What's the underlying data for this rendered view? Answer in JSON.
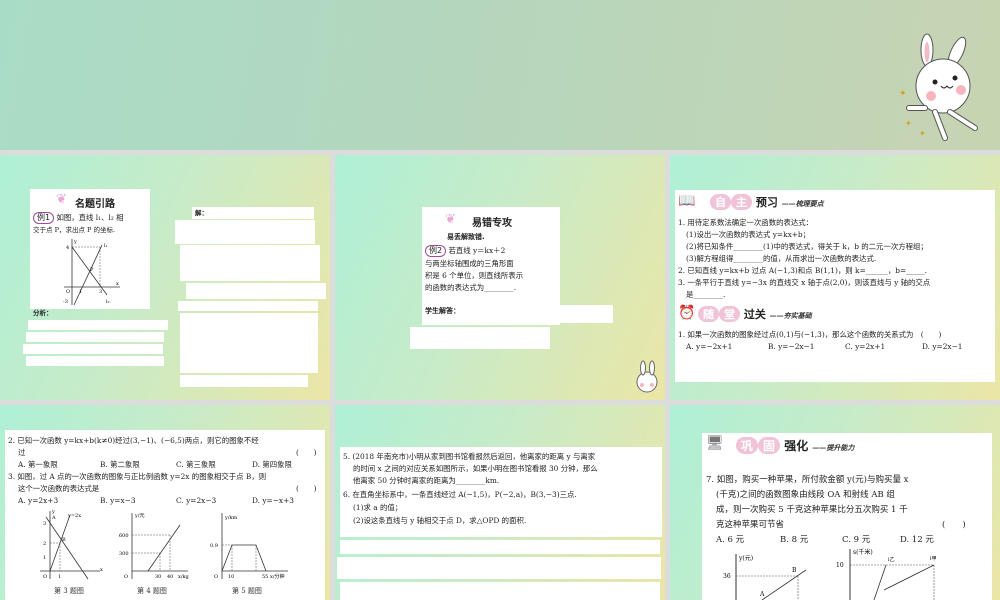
{
  "colors": {
    "banner": "#b4d6bd",
    "pink": "#f1c3d8",
    "mint": "#aef0d6",
    "yellow": "#ebe6a6"
  },
  "icons": [
    "bunny-mascot-icon",
    "butterfly-icon",
    "book-icon",
    "alarm-clock-icon",
    "blackboard-icon"
  ],
  "slide1": {
    "title": "名题引路",
    "example": "例1",
    "q1": "如图，直线 l₁、l₂ 相",
    "q2": "交于点 P，求出点 P 的坐标.",
    "analysis": "分析：",
    "solution": "解：",
    "graph": {
      "y4": "4",
      "ym3": "-3",
      "x1": "1",
      "x3": "3",
      "o": "O",
      "p": "P",
      "l1": "l₁",
      "l2": "l₂",
      "x": "x",
      "y": "y"
    }
  },
  "slide2": {
    "title": "易错专攻",
    "subtitle": "易丢解致错.",
    "example": "例2",
    "lines": [
      "若直线 y＝kx＋2",
      "与两坐标轴围成的三角形面",
      "积是 6 个单位，则直线所表示",
      "的函数的表达式为________."
    ],
    "answer": "学生解答："
  },
  "slide3": {
    "sec1": {
      "pills": [
        "自",
        "主"
      ],
      "title": "预习",
      "sub": "——梳理要点"
    },
    "lines": [
      "1. 用待定系数法确定一次函数的表达式：",
      "(1)设出一次函数的表达式 y=kx+b；",
      "(2)将已知条件________(1)中的表达式，得关于 k，b 的二元一次方程组；",
      "(3)解方程组得________的值，从而求出一次函数的表达式.",
      "2. 已知直线 y=kx+b 过点 A(−1,3)和点 B(1,1)，则 k=______，b=_____.",
      "3. 一条平行于直线 y=−3x 的直线交 x 轴于点(2,0)，则该直线与 y 轴的交点",
      "是________."
    ],
    "sec2": {
      "pills": [
        "随",
        "堂"
      ],
      "title": "过关",
      "sub": "——夯实基础"
    },
    "q1": "1. 如果一次函数的图象经过点(0,1)与(−1,3)，那么这个函数的关系式为　(　　)",
    "opts": [
      "A. y=−2x+1",
      "B. y=−2x−1",
      "C. y=2x+1",
      "D. y=2x−1"
    ]
  },
  "slide4": {
    "q2": "2. 已知一次函数 y=kx+b(k≠0)经过(3,−1)、(−6,5)两点，则它的图象不经",
    "q2b": "过",
    "paren": "(　　)",
    "opts2": [
      "A. 第一象限",
      "B. 第二象限",
      "C. 第三象限",
      "D. 第四象限"
    ],
    "q3": "3. 如图，过 A 点的一次函数的图象与正比例函数 y=2x 的图象相交于点 B，则",
    "q3b": "这个一次函数的表达式是",
    "opts3": [
      "A. y=2x+3",
      "B. y=x−3",
      "C. y=2x−3",
      "D. y=−x+3"
    ],
    "fig3": {
      "caption": "第 3 题图",
      "line": "y=2x",
      "a": "A",
      "b": "B",
      "t3": "3",
      "t2": "2",
      "t1": "1",
      "x1": "1",
      "o": "O",
      "x": "x",
      "y": "y"
    },
    "fig4": {
      "caption": "第 4 题图",
      "ylabel": "y/元",
      "xlabel": "x/kg",
      "y600": "600",
      "y300": "300",
      "x30": "30",
      "x40": "40",
      "o": "O"
    },
    "fig5": {
      "caption": "第 5 题图",
      "ylabel": "y/km",
      "xlabel": "x/分钟",
      "y09": "0.9",
      "x10": "10",
      "x55": "55",
      "o": "O"
    }
  },
  "slide5": {
    "lines": [
      "5. (2018 年南充市)小明从家到图书馆看报然后返回，他离家的距离 y 与离家",
      "的时间 x 之间的对应关系如图所示，如果小明在图书馆看报 30 分钟，那么",
      "他离家 50 分钟时离家的距离为________km.",
      "6. 在直角坐标系中，一条直线经过 A(−1,5)，P(−2,a)，B(3,−3)三点.",
      "(1)求 a 的值；",
      "(2)设这条直线与 y 轴相交于点 D，求△OPD 的面积."
    ]
  },
  "slide6": {
    "pills": [
      "巩",
      "固"
    ],
    "title": "强化",
    "sub": "——提升能力",
    "lines": [
      "7. 如图，购买一种苹果，所付款金额 y(元)与购买量 x",
      "(千克)之间的函数图象由线段 OA 和射线 AB 组",
      "成，则一次购买 5 千克这种苹果比分五次购买 1 千",
      "克这种苹果可节省"
    ],
    "paren": "(　　)",
    "opts": [
      "A. 6 元",
      "B. 8 元",
      "C. 9 元",
      "D. 12 元"
    ],
    "figA": {
      "ylabel": "y(元)",
      "y36": "36",
      "b": "B",
      "a": "A"
    },
    "figB": {
      "ylabel": "s(千米)",
      "y10": "10",
      "l1": "l乙",
      "l2": "l甲"
    }
  }
}
